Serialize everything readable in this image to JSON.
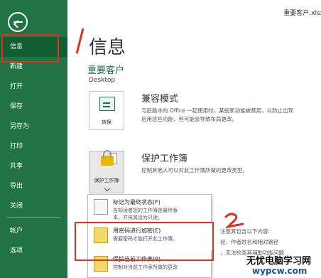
{
  "document_name": "重要客户.xlsx",
  "sidebar": {
    "back_icon": "back-arrow-icon",
    "items": [
      {
        "label": "信息",
        "active": true
      },
      {
        "label": "新建"
      },
      {
        "label": "打开"
      },
      {
        "label": "保存"
      },
      {
        "label": "另存为"
      },
      {
        "label": "打印"
      },
      {
        "label": "共享"
      },
      {
        "label": "导出"
      },
      {
        "label": "关闭"
      },
      {
        "label": "帐户"
      },
      {
        "label": "选项"
      }
    ]
  },
  "info": {
    "title": "信息",
    "workbook_name": "重要客户",
    "location": "Desktop"
  },
  "compatibility": {
    "title": "兼容模式",
    "description": "与旧版本的 Office 一起使用时，某些新功能被禁用，以防止出现\n启用这些功能，但可能会导致布局更改。",
    "button_label": "转换"
  },
  "protect": {
    "title": "保护工作簿",
    "description": "控制其他人可以对此工作簿所做的更改类型。",
    "button_label": "保护工作簿"
  },
  "protect_menu": [
    {
      "title": "标记为最终状态(F)",
      "description": "告知读者您的工作簿是最终版\n本，并将其设为只读。"
    },
    {
      "title": "用密码进行加密(E)",
      "description": "需要密码才能打开此工作簿。"
    },
    {
      "title": "保护当前工作表(P)",
      "description": "控制对当前工作表所做的更改"
    }
  ],
  "inspect_partial": "注意其包含以下内容:\n径、作者姓名和相对路径\n，无法检查其辅助功能问题",
  "annotations": {
    "one": "1",
    "two": "2"
  },
  "watermark": {
    "main": "无忧电脑学习网",
    "url": "wypcw.com"
  },
  "colors": {
    "sidebar": "#217346",
    "active": "#0f5f33",
    "accent": "#217346",
    "annotation": "#e0301e"
  }
}
